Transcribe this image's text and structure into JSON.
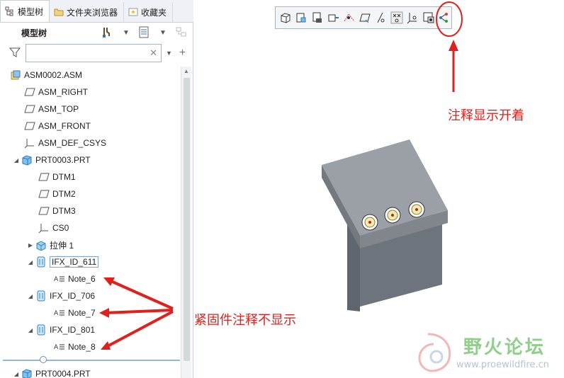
{
  "tabs": [
    {
      "label": "模型树",
      "icon": "model-tree-icon",
      "active": true
    },
    {
      "label": "文件夹浏览器",
      "icon": "folder-browser-icon"
    },
    {
      "label": "收藏夹",
      "icon": "favorites-icon"
    }
  ],
  "tree_header": {
    "title": "模型树"
  },
  "search": {
    "value": "",
    "placeholder": ""
  },
  "tree": [
    {
      "label": "ASM0002.ASM",
      "icon": "assembly-icon"
    },
    {
      "label": "ASM_RIGHT",
      "icon": "datum-plane-icon"
    },
    {
      "label": "ASM_TOP",
      "icon": "datum-plane-icon"
    },
    {
      "label": "ASM_FRONT",
      "icon": "datum-plane-icon"
    },
    {
      "label": "ASM_DEF_CSYS",
      "icon": "csys-icon"
    },
    {
      "label": "PRT0003.PRT",
      "icon": "part-icon"
    },
    {
      "label": "DTM1",
      "icon": "datum-plane-icon"
    },
    {
      "label": "DTM2",
      "icon": "datum-plane-icon"
    },
    {
      "label": "DTM3",
      "icon": "datum-plane-icon"
    },
    {
      "label": "CS0",
      "icon": "csys-icon"
    },
    {
      "label": "拉伸 1",
      "icon": "extrude-icon"
    },
    {
      "label": "IFX_ID_611",
      "icon": "fastener-icon"
    },
    {
      "label": "Note_6",
      "icon": "note-icon"
    },
    {
      "label": "IFX_ID_706",
      "icon": "fastener-icon"
    },
    {
      "label": "Note_7",
      "icon": "note-icon"
    },
    {
      "label": "IFX_ID_801",
      "icon": "fastener-icon"
    },
    {
      "label": "Note_8",
      "icon": "note-icon"
    },
    {
      "label": "PRT0004.PRT",
      "icon": "part-icon"
    }
  ],
  "annotations": {
    "toolbar_callout": "注释显示开着",
    "tree_callout": "紧固件注释不显示"
  },
  "watermark": {
    "title": "野火论坛",
    "url": "www.proewildfire.cn"
  },
  "colors": {
    "annotation_red": "#e0201c",
    "model_gray": "#8a9098",
    "selection_blue": "#7ea3d3"
  }
}
